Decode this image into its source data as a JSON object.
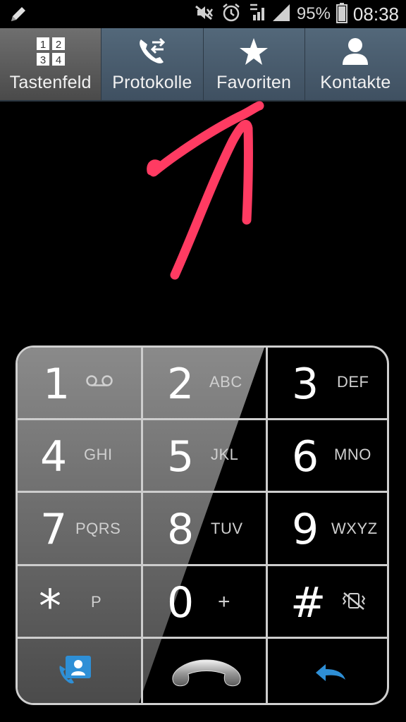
{
  "status_bar": {
    "battery_percent": "95%",
    "time": "08:38",
    "icons": [
      "pencil-icon",
      "mute-icon",
      "alarm-icon",
      "data-signal-icon",
      "cell-signal-icon",
      "battery-icon"
    ]
  },
  "tabs": [
    {
      "label": "Tastenfeld",
      "icon": "dialpad-icon",
      "active": true
    },
    {
      "label": "Protokolle",
      "icon": "call-log-icon",
      "active": false
    },
    {
      "label": "Favoriten",
      "icon": "star-icon",
      "active": false
    },
    {
      "label": "Kontakte",
      "icon": "contact-icon",
      "active": false
    }
  ],
  "keypad": {
    "keys": [
      {
        "digit": "1",
        "letters": ""
      },
      {
        "digit": "2",
        "letters": "ABC"
      },
      {
        "digit": "3",
        "letters": "DEF"
      },
      {
        "digit": "4",
        "letters": "GHI"
      },
      {
        "digit": "5",
        "letters": "JKL"
      },
      {
        "digit": "6",
        "letters": "MNO"
      },
      {
        "digit": "7",
        "letters": "PQRS"
      },
      {
        "digit": "8",
        "letters": "TUV"
      },
      {
        "digit": "9",
        "letters": "WXYZ"
      },
      {
        "digit": "*",
        "letters": "P"
      },
      {
        "digit": "0",
        "letters": "+"
      },
      {
        "digit": "#",
        "letters": ""
      }
    ],
    "bottom_row": [
      "add-contact-icon",
      "call-icon",
      "back-icon"
    ]
  },
  "colors": {
    "annotation_arrow": "#ff3b62",
    "tab_bar": "#465868",
    "accent_blue": "#2e8fd6"
  }
}
